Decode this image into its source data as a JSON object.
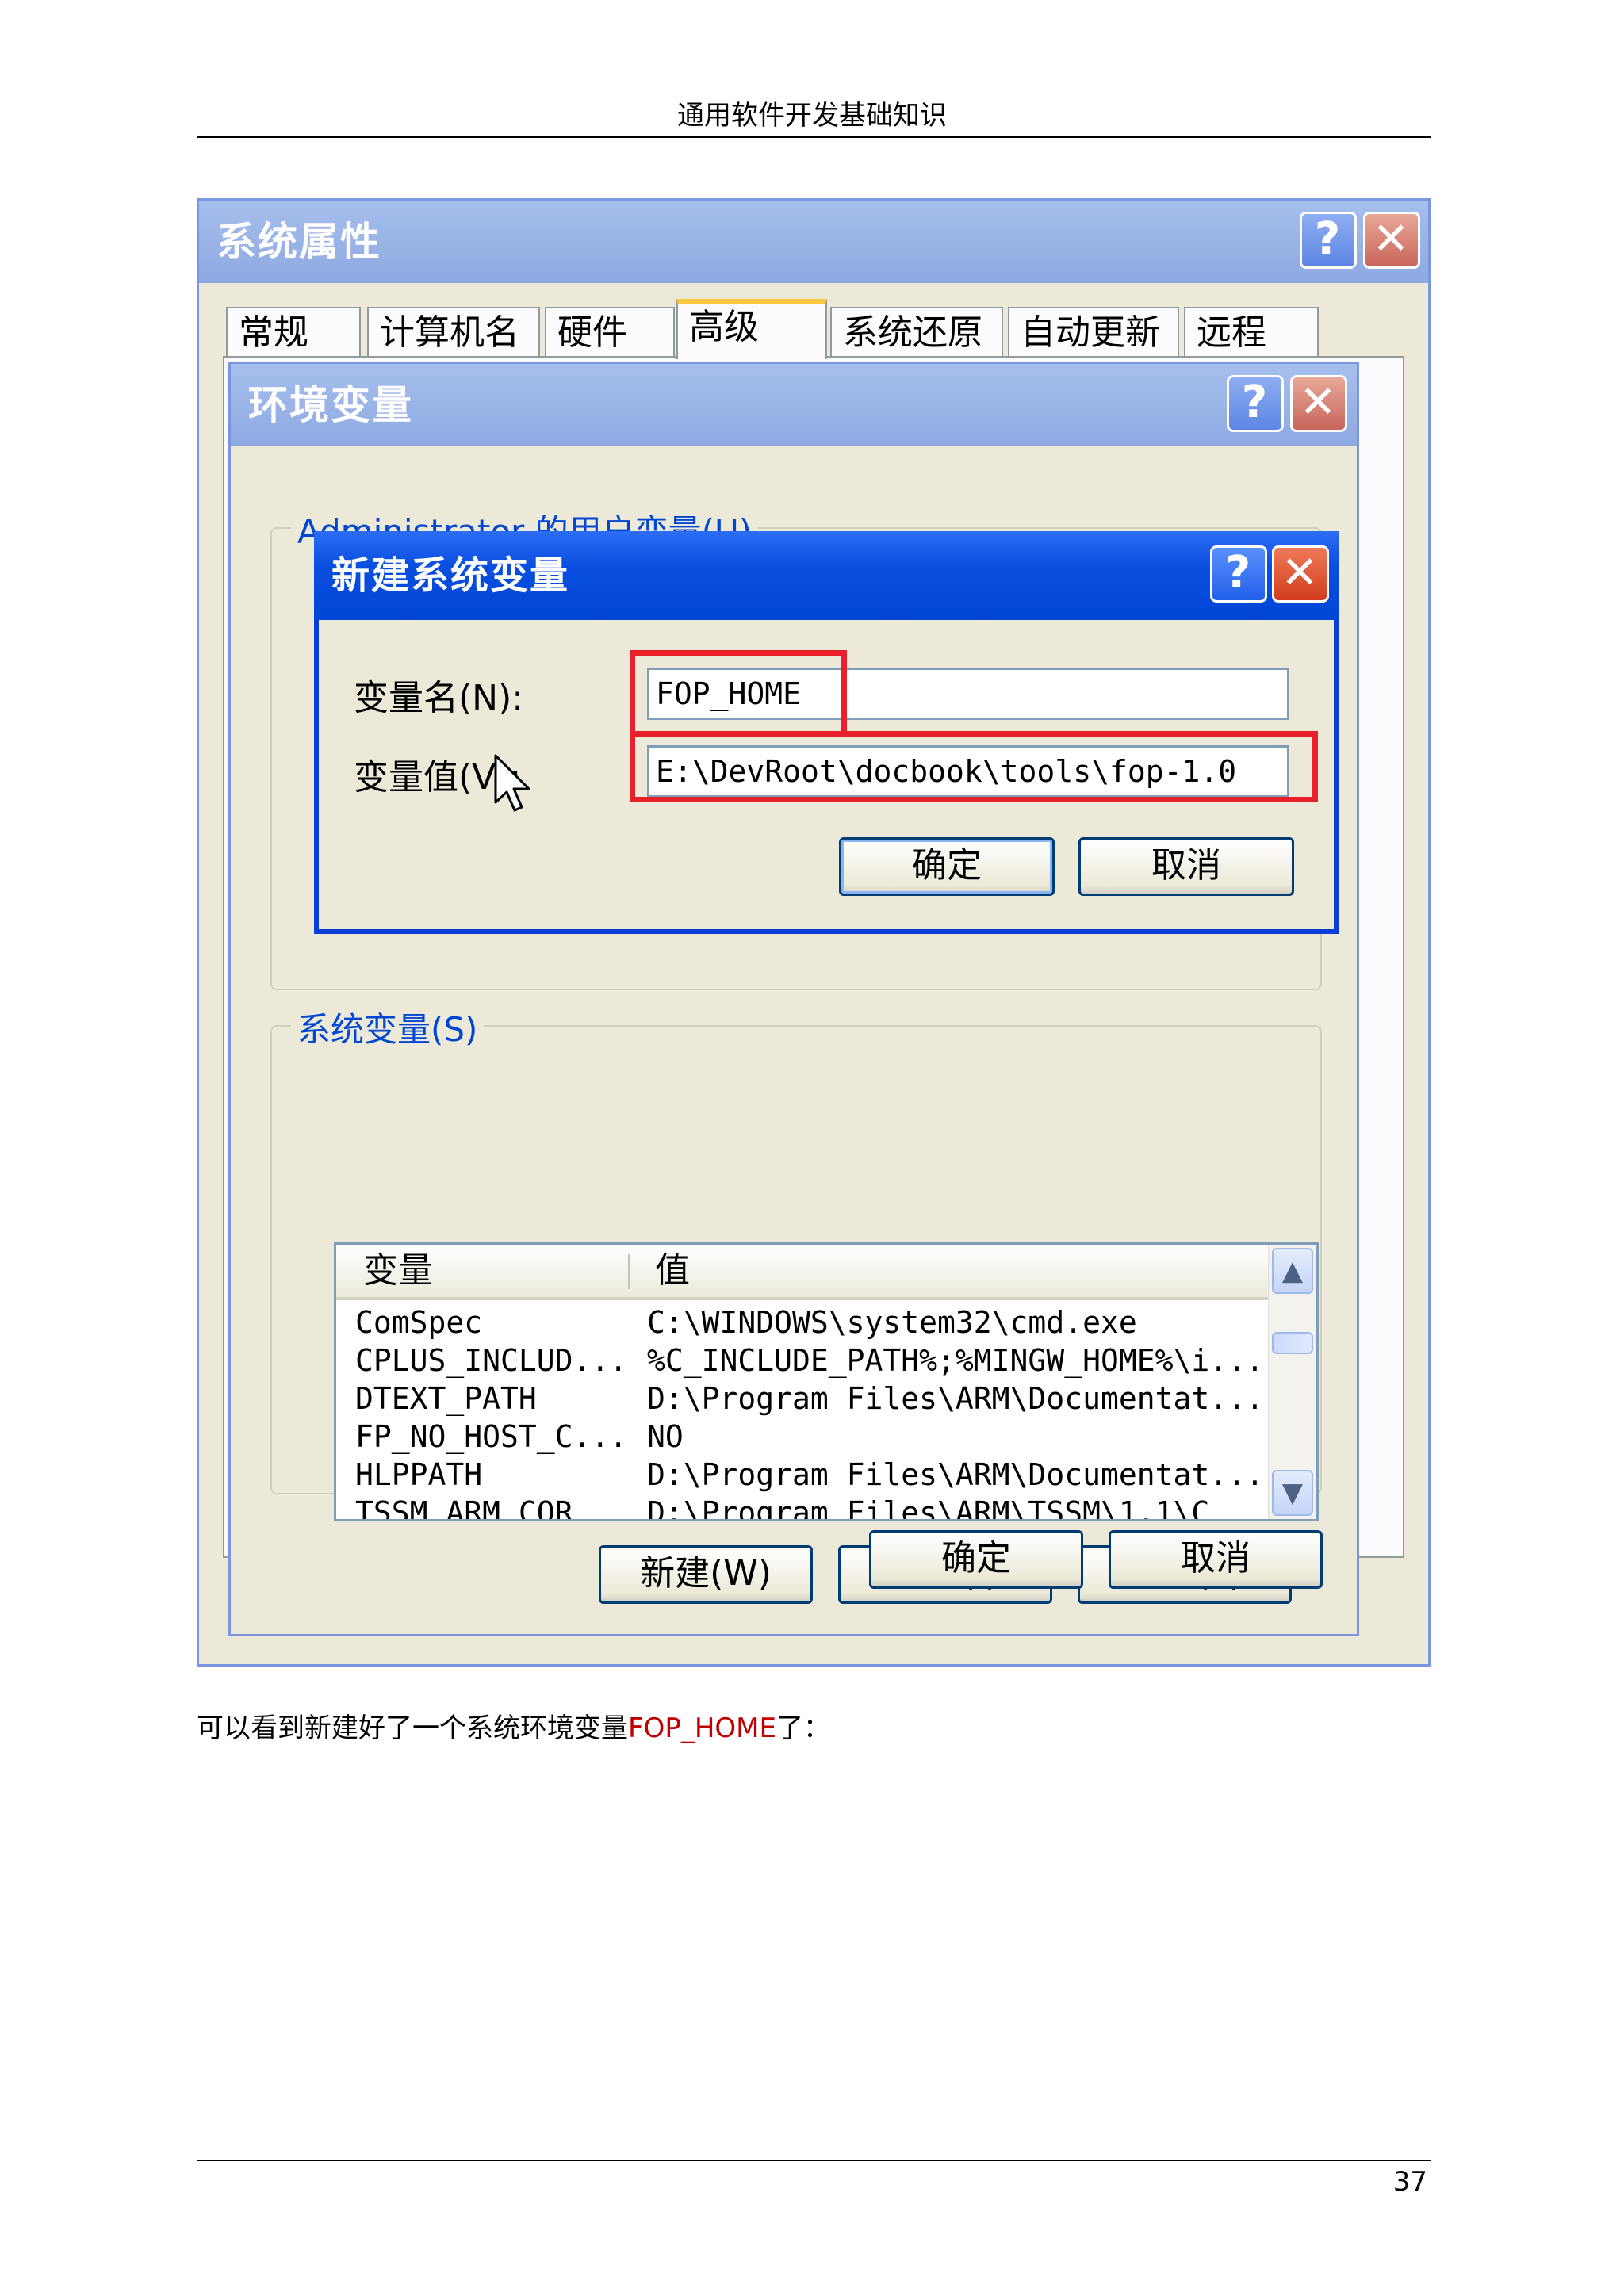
{
  "header": {
    "title": "通用软件开发基础知识"
  },
  "system_properties": {
    "title": "系统属性",
    "help_glyph": "?",
    "close_glyph": "✕",
    "tabs": [
      "常规",
      "计算机名",
      "硬件",
      "高级",
      "系统还原",
      "自动更新",
      "远程"
    ],
    "selected_tab": "高级"
  },
  "env_dialog": {
    "title": "环境变量",
    "user_vars_label": "Administrator 的用户变量(U)",
    "system_vars_label": "系统变量(S)",
    "columns": [
      "变量",
      "值"
    ],
    "rows": [
      [
        "ComSpec",
        "C:\\WINDOWS\\system32\\cmd.exe"
      ],
      [
        "CPLUS_INCLUD...",
        "%C_INCLUDE_PATH%;%MINGW_HOME%\\i..."
      ],
      [
        "DTEXT_PATH",
        "D:\\Program Files\\ARM\\Documentat..."
      ],
      [
        "FP_NO_HOST_C...",
        "NO"
      ],
      [
        "HLPPATH",
        "D:\\Program Files\\ARM\\Documentat..."
      ],
      [
        "TSSM_ARM_COR",
        "D:\\Program Files\\ARM\\TSSM\\1.1\\C"
      ]
    ],
    "buttons": {
      "new": "新建(W)",
      "edit": "编辑(I)",
      "delete": "删除(L)",
      "ok": "确定",
      "cancel": "取消"
    }
  },
  "new_var_dialog": {
    "title": "新建系统变量",
    "name_label": "变量名(N):",
    "value_label": "变量值(V):",
    "name_value": "FOP_HOME",
    "value_value": "E:\\DevRoot\\docbook\\tools\\fop-1.0",
    "ok": "确定",
    "cancel": "取消"
  },
  "caption": {
    "before": "可以看到新建好了一个系统环境变量",
    "highlight": "FOP_HOME",
    "after": "了："
  },
  "footer": {
    "page_number": "37"
  },
  "colors": {
    "highlight_red": "#e8202c",
    "caption_red": "#c00000",
    "xp_blue": "#0046d5"
  }
}
